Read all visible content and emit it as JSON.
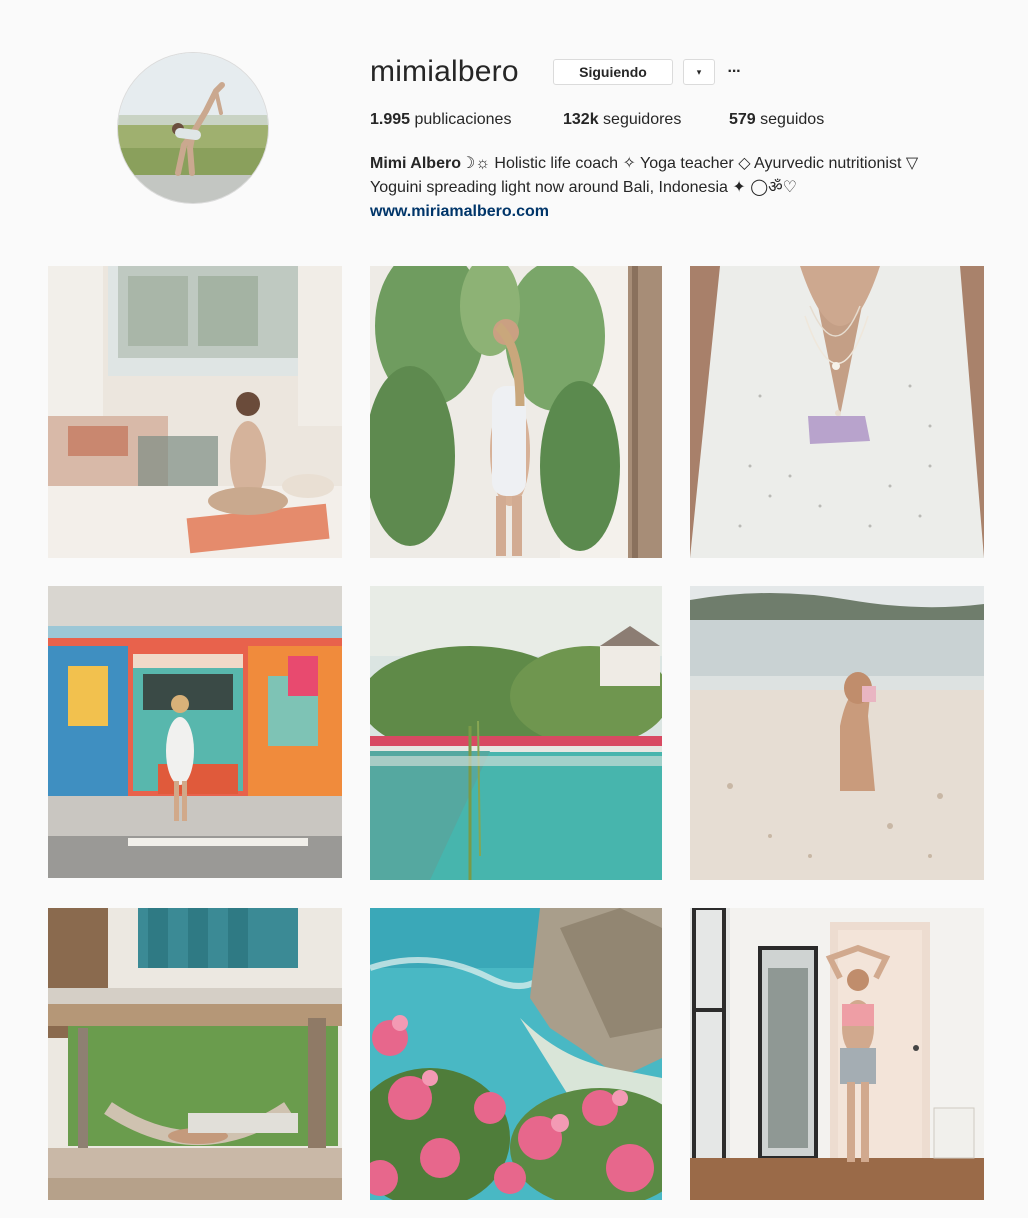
{
  "profile": {
    "username": "mimialbero",
    "follow_label": "Siguiendo",
    "dropdown_glyph": "▾",
    "more_glyph": "···",
    "stats": {
      "posts_count": "1.995",
      "posts_label": "publicaciones",
      "followers_count": "132k",
      "followers_label": "seguidores",
      "following_count": "579",
      "following_label": "seguidos"
    },
    "bio": {
      "name": "Mimi Albero",
      "line1": "☽☼ Holistic life coach ✧ Yoga teacher ◇ Ayurvedic nutritionist ▽",
      "line2": "Yoguini spreading light now around Bali, Indonesia ✦ ◯ॐ♡",
      "website": "www.miriamalbero.com"
    },
    "icons": {
      "avatar": "profile-photo",
      "dropdown": "chevron-down-icon",
      "more": "ellipsis-icon"
    }
  },
  "posts": [
    {
      "subject": "yoga-meditation-lounge",
      "colors": [
        "#e9e2da",
        "#c98a72"
      ]
    },
    {
      "subject": "tropical-leaves-swimsuit",
      "colors": [
        "#6f9a5e",
        "#f1ece6"
      ]
    },
    {
      "subject": "polka-dot-dress-closeup",
      "colors": [
        "#eeeeec",
        "#c9a792"
      ]
    },
    {
      "subject": "colorful-mural-kiosk",
      "colors": [
        "#e35b48",
        "#52b3a9"
      ]
    },
    {
      "subject": "resort-infinity-pool",
      "colors": [
        "#46b7b0",
        "#6e8f4e"
      ]
    },
    {
      "subject": "beach-forward-bend",
      "colors": [
        "#e9e3dc",
        "#bfc8c9"
      ]
    },
    {
      "subject": "hammock-terrace",
      "colors": [
        "#3a7f8a",
        "#6a9c4d"
      ]
    },
    {
      "subject": "cliff-ocean-bougainvillea",
      "colors": [
        "#4ec0c9",
        "#e8618a"
      ]
    },
    {
      "subject": "white-room-stretch",
      "colors": [
        "#f3f1ee",
        "#e79a9c"
      ]
    }
  ]
}
